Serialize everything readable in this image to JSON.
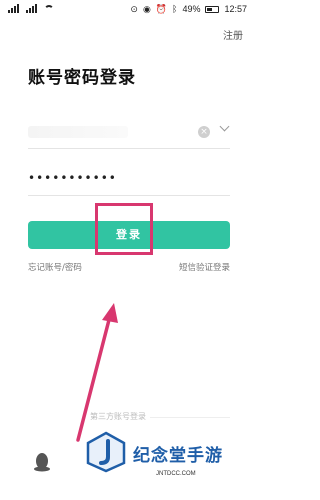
{
  "status_bar": {
    "battery": "49%",
    "time": "12:57"
  },
  "header": {
    "register_label": "注册",
    "title": "账号密码登录"
  },
  "form": {
    "password_masked": "•••••••••••",
    "login_label": "登录"
  },
  "links": {
    "forgot": "忘记账号/密码",
    "sms_login": "短信验证登录"
  },
  "third_party": {
    "label": "第三方账号登录"
  },
  "watermark": {
    "title": "纪念堂手游",
    "url": "JNTDCC.COM"
  },
  "colors": {
    "accent": "#31c4a2",
    "highlight": "#d8376f",
    "watermark": "#1f5ea8"
  }
}
